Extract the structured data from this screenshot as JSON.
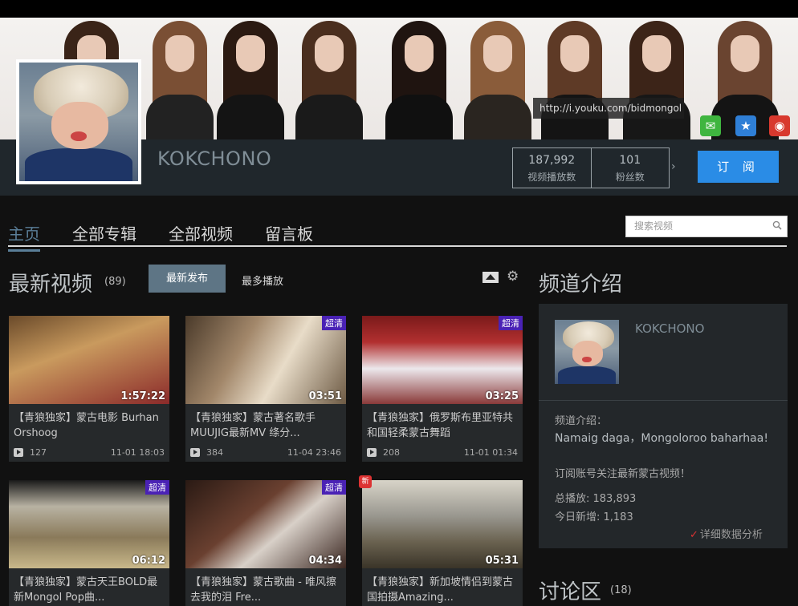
{
  "banner": {
    "url": "http://i.youku.com/bidmongol",
    "share": [
      {
        "icon": "wechat-icon",
        "glyph": "✉",
        "color": "#3fb53f"
      },
      {
        "icon": "qzone-icon",
        "glyph": "★",
        "color": "#2f7fd6"
      },
      {
        "icon": "weibo-icon",
        "glyph": "◉",
        "color": "#d8392e"
      }
    ]
  },
  "channel": {
    "name": "KOKCHONO",
    "stats": {
      "views_value": "187,992",
      "views_label": "视频播放数",
      "fans_value": "101",
      "fans_label": "粉丝数"
    },
    "subscribe_label": "订 阅"
  },
  "tabs": [
    "主页",
    "全部专辑",
    "全部视频",
    "留言板"
  ],
  "search": {
    "placeholder": "搜索视频"
  },
  "latest": {
    "title": "最新视频",
    "count": "(89)",
    "sort_latest": "最新发布",
    "sort_popular": "最多播放"
  },
  "videos": [
    {
      "title": "【青狼独家】蒙古电影 Burhan Orshoog",
      "duration": "1:57:22",
      "plays": "127",
      "date": "11-01 18:03",
      "hd": "",
      "new": ""
    },
    {
      "title": "【青狼独家】蒙古著名歌手MUUJIG最新MV 绦分...",
      "duration": "03:51",
      "plays": "384",
      "date": "11-04 23:46",
      "hd": "超清",
      "new": ""
    },
    {
      "title": "【青狼独家】俄罗斯布里亚特共和国轻柔蒙古舞蹈",
      "duration": "03:25",
      "plays": "208",
      "date": "11-01 01:34",
      "hd": "超清",
      "new": ""
    },
    {
      "title": "【青狼独家】蒙古天王BOLD最新Mongol Pop曲...",
      "duration": "06:12",
      "plays": "",
      "date": "",
      "hd": "超清",
      "new": ""
    },
    {
      "title": "【青狼独家】蒙古歌曲 - 唯风擦去我的泪 Fre...",
      "duration": "04:34",
      "plays": "",
      "date": "",
      "hd": "超清",
      "new": ""
    },
    {
      "title": "【青狼独家】新加坡情侣到蒙古国拍摄Amazing...",
      "duration": "05:31",
      "plays": "",
      "date": "",
      "hd": "",
      "new": "新"
    }
  ],
  "sidebar": {
    "title": "频道介绍",
    "name": "KOKCHONO",
    "intro_label": "频道介绍：",
    "intro_text": "Namaig daga，Mongoloroo baharhaa!",
    "intro_text2": "订阅账号关注最新蒙古视频！",
    "total_views": "总播放: 183,893",
    "today_new": "今日新增: 1,183",
    "detail_link": "详细数据分析"
  },
  "discussion": {
    "title": "讨论区",
    "count": "(18)"
  },
  "colors": {
    "accent": "#2a8ce6",
    "tab_active": "#5a7e98",
    "hd_badge": "#4a22b5",
    "header": "#20272c"
  }
}
